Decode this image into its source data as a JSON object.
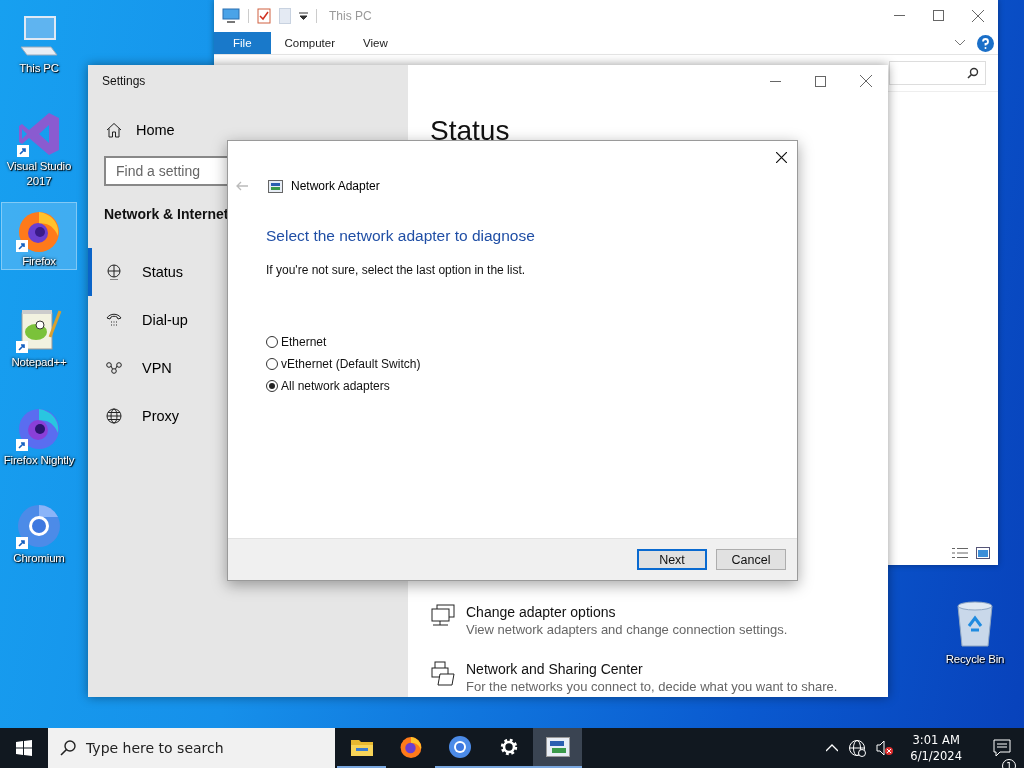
{
  "desktop_icons": [
    {
      "kind": "computer",
      "label": "This PC",
      "shortcut": false,
      "selected": false
    },
    {
      "kind": "studio",
      "label": "Visual Studio 2017",
      "shortcut": true,
      "selected": false
    },
    {
      "kind": "firefox",
      "label": "Firefox",
      "shortcut": true,
      "selected": true
    },
    {
      "kind": "notepad",
      "label": "Notepad++",
      "shortcut": true,
      "selected": false
    },
    {
      "kind": "nightly",
      "label": "Firefox Nightly",
      "shortcut": true,
      "selected": false
    },
    {
      "kind": "chromium",
      "label": "Chromium",
      "shortcut": true,
      "selected": false
    }
  ],
  "recycle_bin": {
    "label": "Recycle Bin"
  },
  "explorer": {
    "title": "This PC",
    "ribbon_tabs": [
      {
        "label": "File",
        "selected": true
      },
      {
        "label": "Computer",
        "selected": false
      },
      {
        "label": "View",
        "selected": false
      }
    ]
  },
  "settings": {
    "title": "Settings",
    "home": "Home",
    "search": {
      "placeholder": "Find a setting"
    },
    "section": "Network & Internet",
    "nav": [
      {
        "kind": "status",
        "label": "Status",
        "selected": true
      },
      {
        "kind": "dialup",
        "label": "Dial-up",
        "selected": false
      },
      {
        "kind": "vpn",
        "label": "VPN",
        "selected": false
      },
      {
        "kind": "proxy",
        "label": "Proxy",
        "selected": false
      }
    ],
    "page_title": "Status",
    "links": [
      {
        "kind": "adapter",
        "title": "Change adapter options",
        "description": "View network adapters and change connection settings."
      },
      {
        "kind": "sharing",
        "title": "Network and Sharing Center",
        "description": "For the networks you connect to, decide what you want to share."
      }
    ]
  },
  "dialog": {
    "title": "Network Adapter",
    "heading": "Select the network adapter to diagnose",
    "hint": "If you're not sure, select the last option in the list.",
    "options": [
      {
        "label": "Ethernet",
        "selected": false
      },
      {
        "label": "vEthernet (Default Switch)",
        "selected": false
      },
      {
        "label": "All network adapters",
        "selected": true
      }
    ],
    "buttons": [
      {
        "label": "Next",
        "default": true
      },
      {
        "label": "Cancel",
        "default": false
      }
    ]
  },
  "taskbar": {
    "search_placeholder": "Type here to search",
    "apps": [
      {
        "kind": "explorer",
        "running": true,
        "active": false
      },
      {
        "kind": "firefox",
        "running": false,
        "active": false
      },
      {
        "kind": "chromium",
        "running": true,
        "active": false
      },
      {
        "kind": "settings",
        "running": true,
        "active": false
      },
      {
        "kind": "adapter",
        "running": true,
        "active": true
      }
    ],
    "time": "3:01 AM",
    "date": "6/1/2024",
    "notification_count": "1"
  }
}
